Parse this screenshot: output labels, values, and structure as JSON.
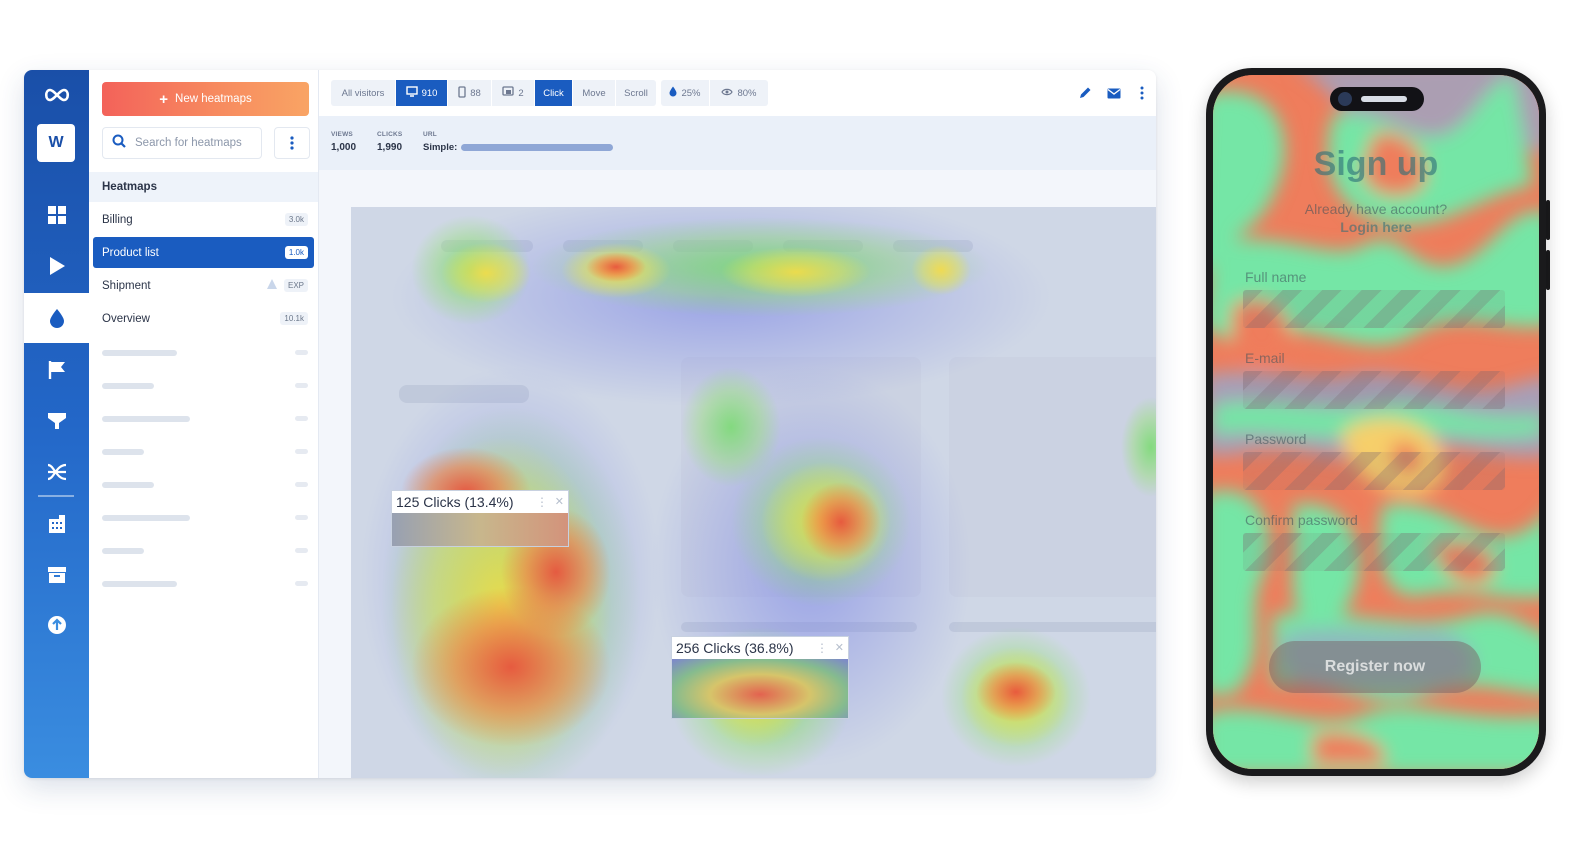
{
  "sidebar": {
    "workspace_initial": "W",
    "nav_icons": [
      "dashboard-icon",
      "play-icon",
      "heatmap-drop-icon",
      "flag-icon",
      "funnel-icon",
      "journey-icon",
      "building-icon",
      "archive-icon",
      "upload-icon"
    ],
    "active_nav": "heatmap-drop-icon"
  },
  "heatmaps_panel": {
    "new_button_label": "New heatmaps",
    "search_placeholder": "Search for heatmaps",
    "section_title": "Heatmaps",
    "items": [
      {
        "label": "Billing",
        "count": "3.0k"
      },
      {
        "label": "Product list",
        "count": "1.0k",
        "selected": true
      },
      {
        "label": "Shipment",
        "count": "EXP",
        "warning": true
      },
      {
        "label": "Overview",
        "count": "10.1k"
      }
    ]
  },
  "toolbar": {
    "audience": "All visitors",
    "desktop_count": "910",
    "mobile_count": "88",
    "tablet_count": "2",
    "modes": [
      "Click",
      "Move",
      "Scroll"
    ],
    "active_mode": "Click",
    "opacity": "25%",
    "visibility": "80%"
  },
  "stats": {
    "views_label": "VIEWS",
    "views_value": "1,000",
    "clicks_label": "CLICKS",
    "clicks_value": "1,990",
    "url_label": "URL",
    "url_prefix": "Simple:"
  },
  "tooltips": [
    {
      "text": "125 Clicks (13.4%)"
    },
    {
      "text": "256 Clicks (36.8%)"
    }
  ],
  "phone": {
    "title": "Sign up",
    "subtitle": "Already have account?",
    "login_link": "Login here",
    "fields": [
      "Full name",
      "E-mail",
      "Password",
      "Confirm password"
    ],
    "cta": "Register now"
  },
  "colors": {
    "brand_blue": "#1a5cc0",
    "cta_gradient_start": "#f3625a",
    "cta_gradient_end": "#f9a464",
    "heat_red": "#e8503c",
    "heat_green": "#78dc6e"
  }
}
